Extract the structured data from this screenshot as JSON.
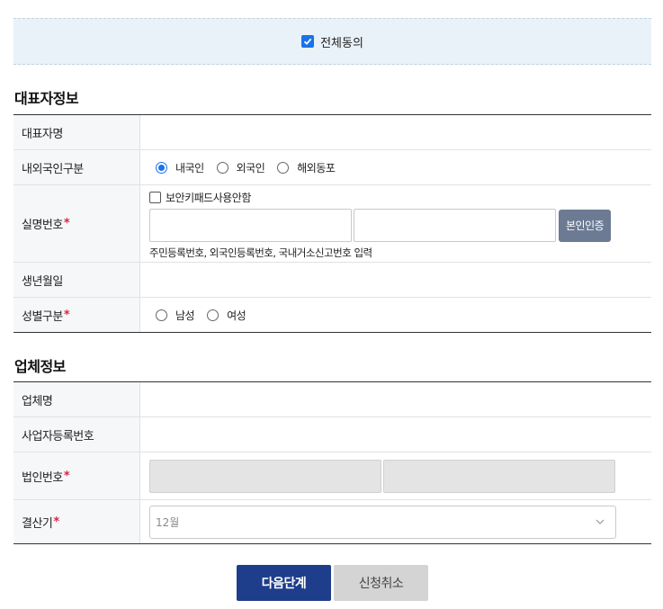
{
  "agree_all": {
    "label": "전체동의",
    "checked": true
  },
  "representative": {
    "section_title": "대표자정보",
    "name_label": "대표자명",
    "name_value": "",
    "nationality_label": "내외국인구분",
    "nationality_options": [
      "내국인",
      "외국인",
      "해외동포"
    ],
    "nationality_selected": "내국인",
    "id_label": "실명번호",
    "required_mark": "*",
    "secure_keypad_label": "보안키패드사용안함",
    "id_part1": "",
    "id_part2": "",
    "verify_button": "본인인증",
    "id_help": "주민등록번호, 외국인등록번호, 국내거소신고번호 입력",
    "birth_label": "생년월일",
    "birth_value": "",
    "gender_label": "성별구분",
    "gender_options": [
      "남성",
      "여성"
    ]
  },
  "company": {
    "section_title": "업체정보",
    "name_label": "업체명",
    "name_value": "",
    "bizno_label": "사업자등록번호",
    "bizno_value": "",
    "corpno_label": "법인번호",
    "fiscal_label": "결산기",
    "fiscal_value": "12월"
  },
  "buttons": {
    "next": "다음단계",
    "cancel": "신청취소"
  },
  "colors": {
    "accent": "#1a73e8",
    "primary_button": "#1e3d8a",
    "required": "#d4284c"
  }
}
